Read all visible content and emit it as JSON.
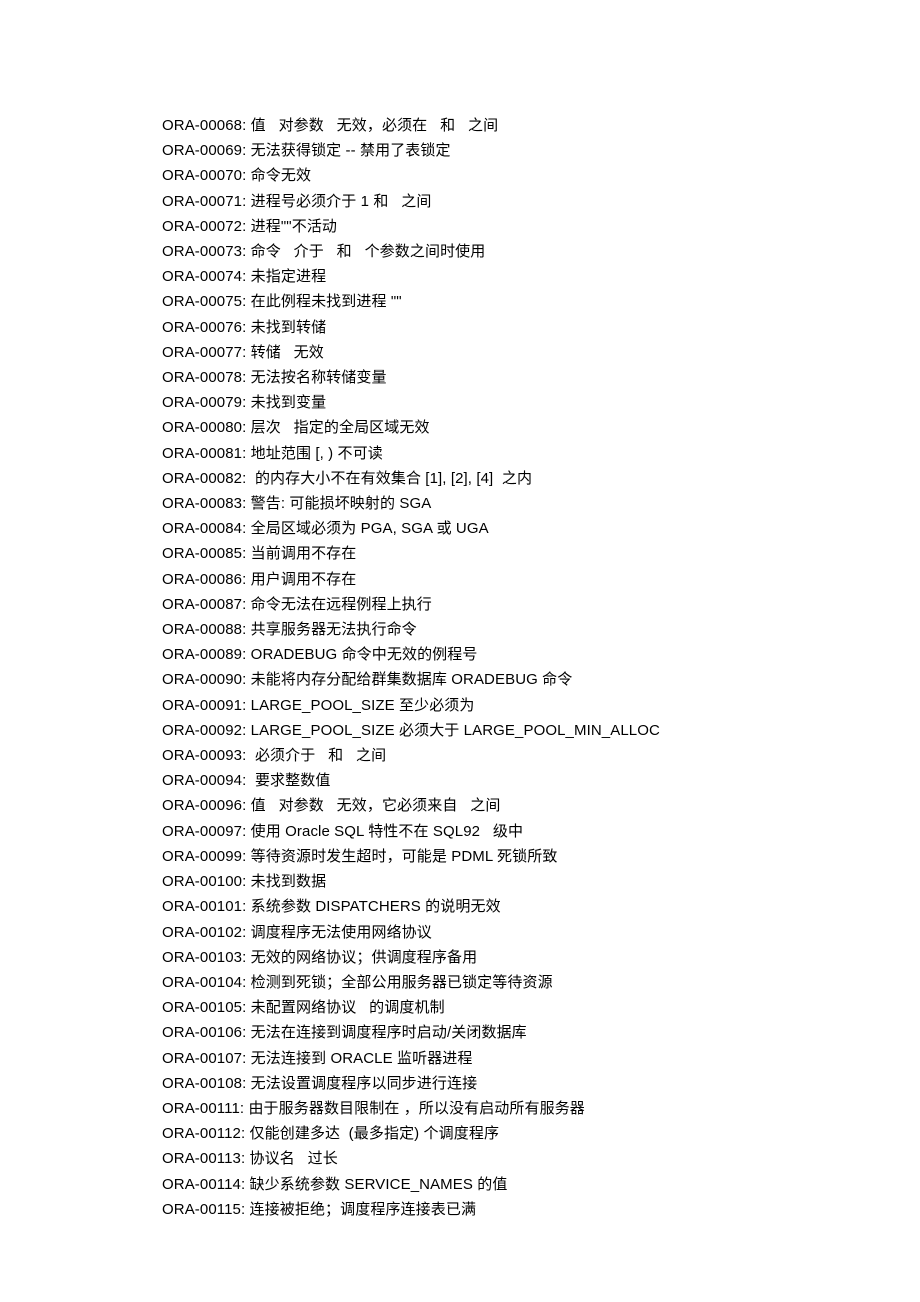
{
  "errors": [
    {
      "code": "ORA-00068",
      "msg": "值   对参数   无效，必须在   和   之间"
    },
    {
      "code": "ORA-00069",
      "msg": "无法获得锁定 -- 禁用了表锁定"
    },
    {
      "code": "ORA-00070",
      "msg": "命令无效"
    },
    {
      "code": "ORA-00071",
      "msg": "进程号必须介于 1 和   之间"
    },
    {
      "code": "ORA-00072",
      "msg": "进程\"\"不活动"
    },
    {
      "code": "ORA-00073",
      "msg": "命令   介于   和   个参数之间时使用"
    },
    {
      "code": "ORA-00074",
      "msg": "未指定进程"
    },
    {
      "code": "ORA-00075",
      "msg": "在此例程未找到进程 \"\""
    },
    {
      "code": "ORA-00076",
      "msg": "未找到转储"
    },
    {
      "code": "ORA-00077",
      "msg": "转储   无效"
    },
    {
      "code": "ORA-00078",
      "msg": "无法按名称转储变量"
    },
    {
      "code": "ORA-00079",
      "msg": "未找到变量"
    },
    {
      "code": "ORA-00080",
      "msg": "层次   指定的全局区域无效"
    },
    {
      "code": "ORA-00081",
      "msg": "地址范围 [, ) 不可读"
    },
    {
      "code": "ORA-00082",
      "msg": " 的内存大小不在有效集合 [1], [2], [4]  之内"
    },
    {
      "code": "ORA-00083",
      "msg": "警告: 可能损坏映射的 SGA"
    },
    {
      "code": "ORA-00084",
      "msg": "全局区域必须为 PGA, SGA 或 UGA"
    },
    {
      "code": "ORA-00085",
      "msg": "当前调用不存在"
    },
    {
      "code": "ORA-00086",
      "msg": "用户调用不存在"
    },
    {
      "code": "ORA-00087",
      "msg": "命令无法在远程例程上执行"
    },
    {
      "code": "ORA-00088",
      "msg": "共享服务器无法执行命令"
    },
    {
      "code": "ORA-00089",
      "msg": "ORADEBUG 命令中无效的例程号"
    },
    {
      "code": "ORA-00090",
      "msg": "未能将内存分配给群集数据库 ORADEBUG 命令"
    },
    {
      "code": "ORA-00091",
      "msg": "LARGE_POOL_SIZE 至少必须为"
    },
    {
      "code": "ORA-00092",
      "msg": "LARGE_POOL_SIZE 必须大于 LARGE_POOL_MIN_ALLOC"
    },
    {
      "code": "ORA-00093",
      "msg": " 必须介于   和   之间"
    },
    {
      "code": "ORA-00094",
      "msg": " 要求整数值"
    },
    {
      "code": "ORA-00096",
      "msg": "值   对参数   无效，它必须来自   之间"
    },
    {
      "code": "ORA-00097",
      "msg": "使用 Oracle SQL 特性不在 SQL92   级中"
    },
    {
      "code": "ORA-00099",
      "msg": "等待资源时发生超时，可能是 PDML 死锁所致"
    },
    {
      "code": "ORA-00100",
      "msg": "未找到数据"
    },
    {
      "code": "ORA-00101",
      "msg": "系统参数 DISPATCHERS 的说明无效"
    },
    {
      "code": "ORA-00102",
      "msg": "调度程序无法使用网络协议"
    },
    {
      "code": "ORA-00103",
      "msg": "无效的网络协议；供调度程序备用"
    },
    {
      "code": "ORA-00104",
      "msg": "检测到死锁；全部公用服务器已锁定等待资源"
    },
    {
      "code": "ORA-00105",
      "msg": "未配置网络协议   的调度机制"
    },
    {
      "code": "ORA-00106",
      "msg": "无法在连接到调度程序时启动/关闭数据库"
    },
    {
      "code": "ORA-00107",
      "msg": "无法连接到 ORACLE 监听器进程"
    },
    {
      "code": "ORA-00108",
      "msg": "无法设置调度程序以同步进行连接"
    },
    {
      "code": "ORA-00111",
      "msg": "由于服务器数目限制在 ，所以没有启动所有服务器"
    },
    {
      "code": "ORA-00112",
      "msg": "仅能创建多达  (最多指定) 个调度程序"
    },
    {
      "code": "ORA-00113",
      "msg": "协议名   过长"
    },
    {
      "code": "ORA-00114",
      "msg": "缺少系统参数 SERVICE_NAMES 的值"
    },
    {
      "code": "ORA-00115",
      "msg": "连接被拒绝；调度程序连接表已满"
    }
  ]
}
